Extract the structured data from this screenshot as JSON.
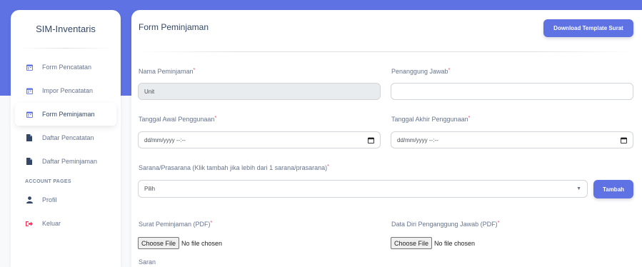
{
  "sidebar": {
    "brand": "SIM-Inventaris",
    "items": [
      {
        "label": "Form Pencatatan",
        "icon": "calendar-icon"
      },
      {
        "label": "Impor Pencatatan",
        "icon": "calendar-icon"
      },
      {
        "label": "Form Peminjaman",
        "icon": "calendar-icon",
        "active": true
      },
      {
        "label": "Daftar Pencatatan",
        "icon": "document-icon"
      },
      {
        "label": "Daftar Peminjaman",
        "icon": "document-icon"
      }
    ],
    "section_label": "ACCOUNT PAGES",
    "account_items": [
      {
        "label": "Profil",
        "icon": "user-icon"
      },
      {
        "label": "Keluar",
        "icon": "logout-icon"
      }
    ]
  },
  "form": {
    "title": "Form Peminjaman",
    "download_label": "Download Template Surat",
    "required_mark": "*",
    "nama_label": "Nama Peminjaman",
    "nama_value": "Unit",
    "penanggung_label": "Penanggung Jawab",
    "penanggung_value": "",
    "tgl_awal_label": "Tanggal Awal Penggunaan",
    "tgl_awal_placeholder": "dd/mm/yyyy --:--",
    "tgl_akhir_label": "Tanggal Akhir Penggunaan",
    "tgl_akhir_placeholder": "dd/mm/yyyy --:--",
    "sarana_label": "Sarana/Prasarana (Klik tambah jika lebih dari 1 sarana/prasarana)",
    "sarana_selected": "Pilih",
    "tambah_label": "Tambah",
    "surat_label": "Surat Peminjaman (PDF)",
    "datadiri_label": "Data Diri Penganggung Jawab (PDF)",
    "file_button": "Choose File",
    "file_status": "No file chosen",
    "saran_label": "Saran"
  },
  "colors": {
    "primary": "#5e72e4",
    "required": "#f5365c"
  }
}
